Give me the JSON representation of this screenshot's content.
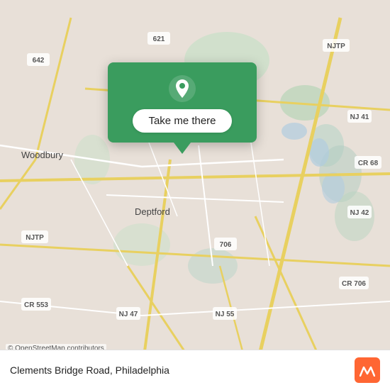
{
  "map": {
    "background_color": "#e8e0d8",
    "center_label": "Deptford",
    "woodbury_label": "Woodbury",
    "route_labels": [
      "621",
      "642",
      "NJTP",
      "NJ 41",
      "CR 68",
      "NJ 42",
      "706",
      "CR 706",
      "CR 553",
      "NJ 47",
      "NJ 55",
      "NJTP"
    ]
  },
  "popup": {
    "button_label": "Take me there",
    "pin_color": "#ffffff"
  },
  "bottom_bar": {
    "location_text": "Clements Bridge Road, Philadelphia",
    "osm_credit": "© OpenStreetMap contributors",
    "moovit_logo_letter": "m"
  }
}
